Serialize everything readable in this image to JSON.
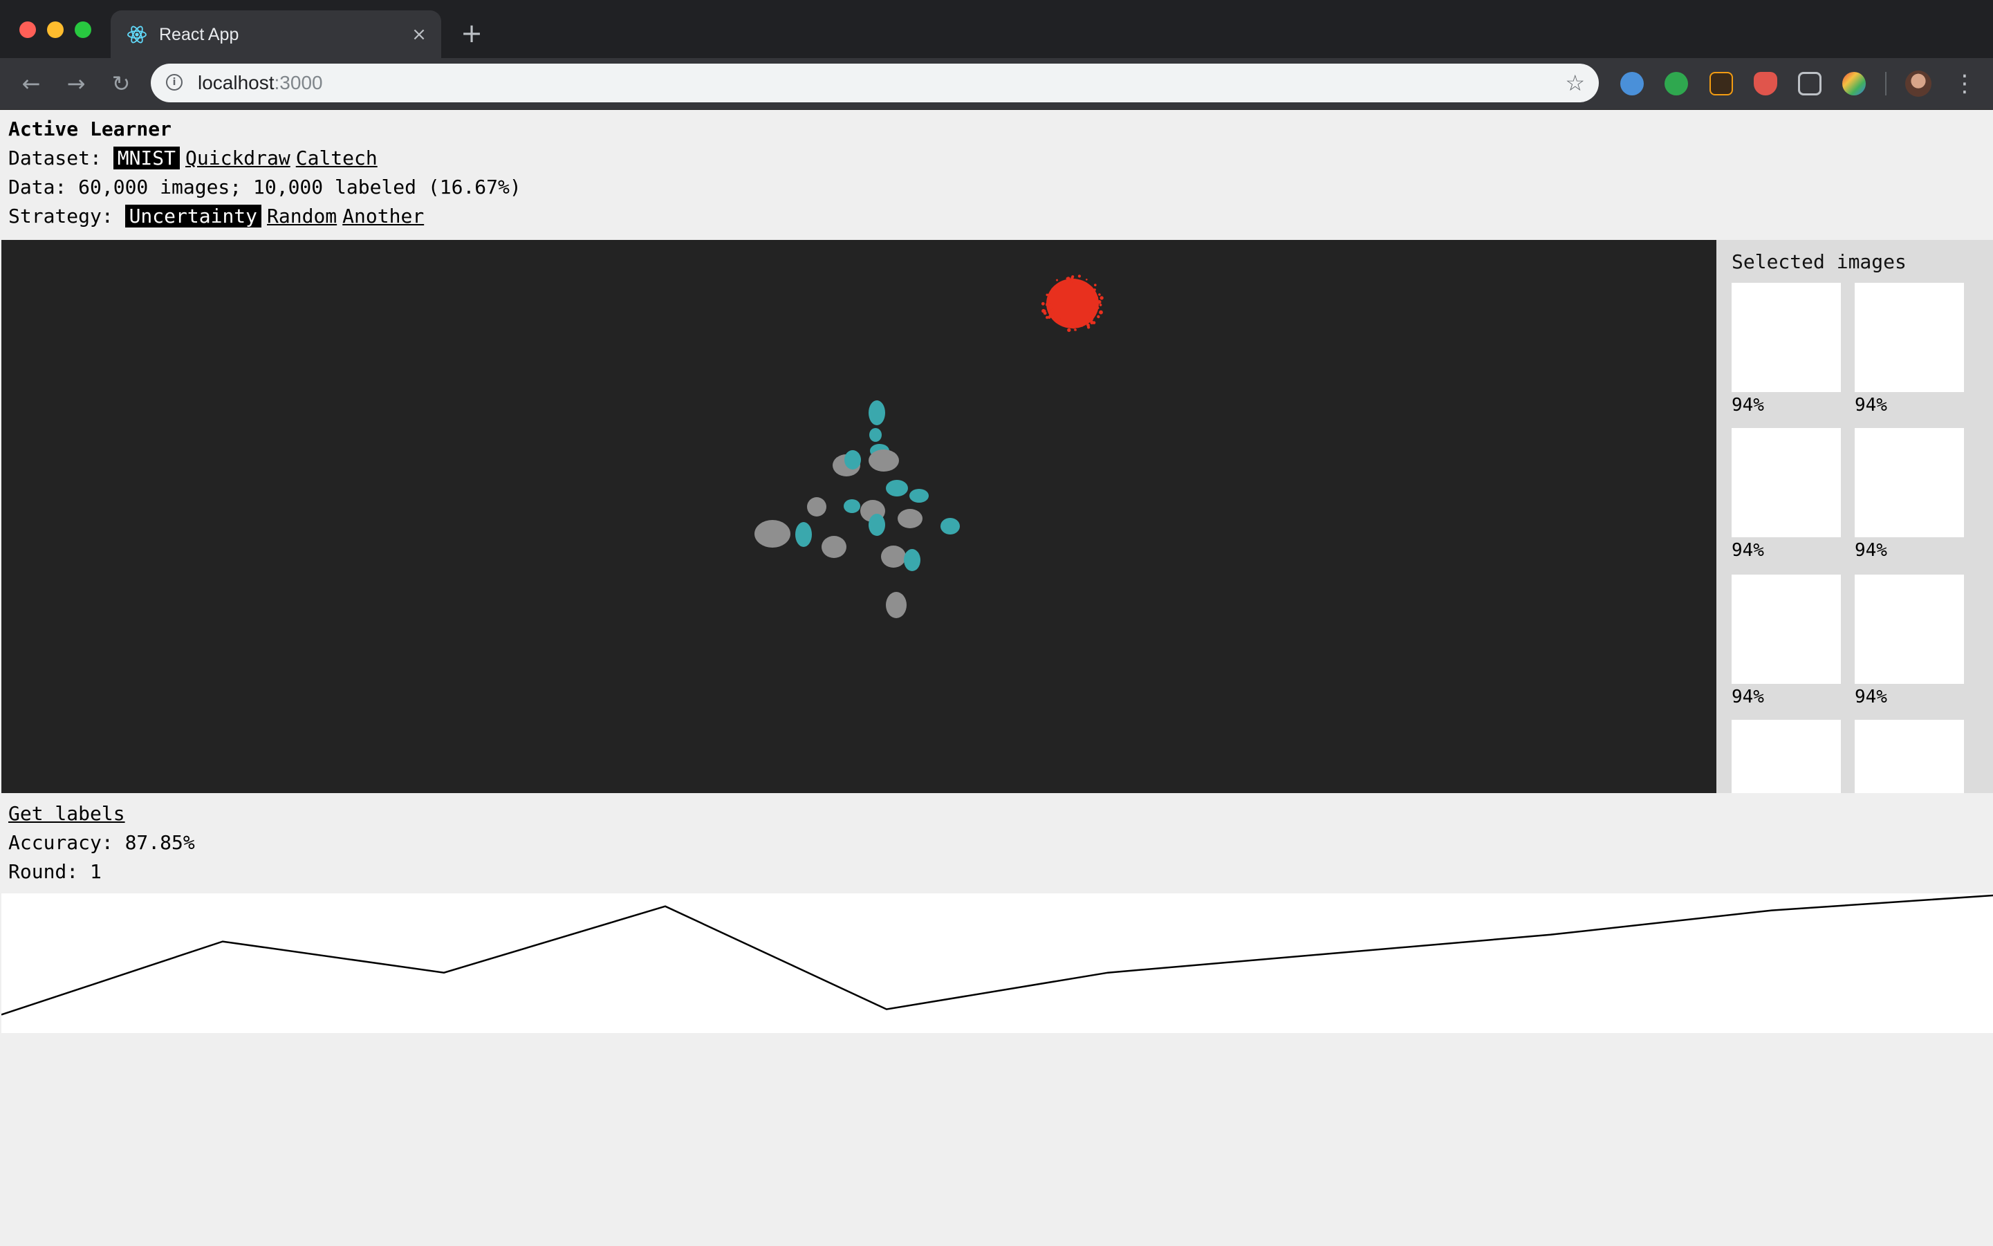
{
  "browser": {
    "tab_title": "React App",
    "tab_close": "×",
    "new_tab": "+",
    "url_host": "localhost",
    "url_port": ":3000"
  },
  "app": {
    "title": "Active Learner",
    "dataset_label": "Dataset:",
    "datasets": [
      "MNIST",
      "Quickdraw",
      "Caltech"
    ],
    "selected_dataset": "MNIST",
    "data_summary": "Data: 60,000 images; 10,000 labeled (16.67%)",
    "strategy_label": "Strategy:",
    "strategies": [
      "Uncertainty",
      "Random",
      "Another"
    ],
    "selected_strategy": "Uncertainty",
    "selected_images_title": "Selected images",
    "selected_images": [
      {
        "confidence": "94%"
      },
      {
        "confidence": "94%"
      },
      {
        "confidence": "94%"
      },
      {
        "confidence": "94%"
      },
      {
        "confidence": "94%"
      },
      {
        "confidence": "94%"
      },
      {
        "confidence": ""
      },
      {
        "confidence": ""
      }
    ],
    "get_labels": "Get labels",
    "accuracy_text": "Accuracy: 87.85%",
    "round_text": "Round: 1"
  },
  "colors": {
    "plot_bg": "#232323",
    "unlabeled": "#8f8f8f",
    "labeled": "#3aa8ad",
    "selected": "#e8301e"
  },
  "chart_data": {
    "type": "line",
    "title": "",
    "xlabel": "",
    "ylabel": "",
    "x": [
      0,
      1,
      2,
      3,
      4,
      5,
      6,
      7,
      8,
      9
    ],
    "values": [
      0.12,
      0.66,
      0.43,
      0.92,
      0.16,
      0.43,
      0.57,
      0.71,
      0.89,
      1.0
    ],
    "ylim": [
      0,
      1
    ],
    "grid": false
  }
}
